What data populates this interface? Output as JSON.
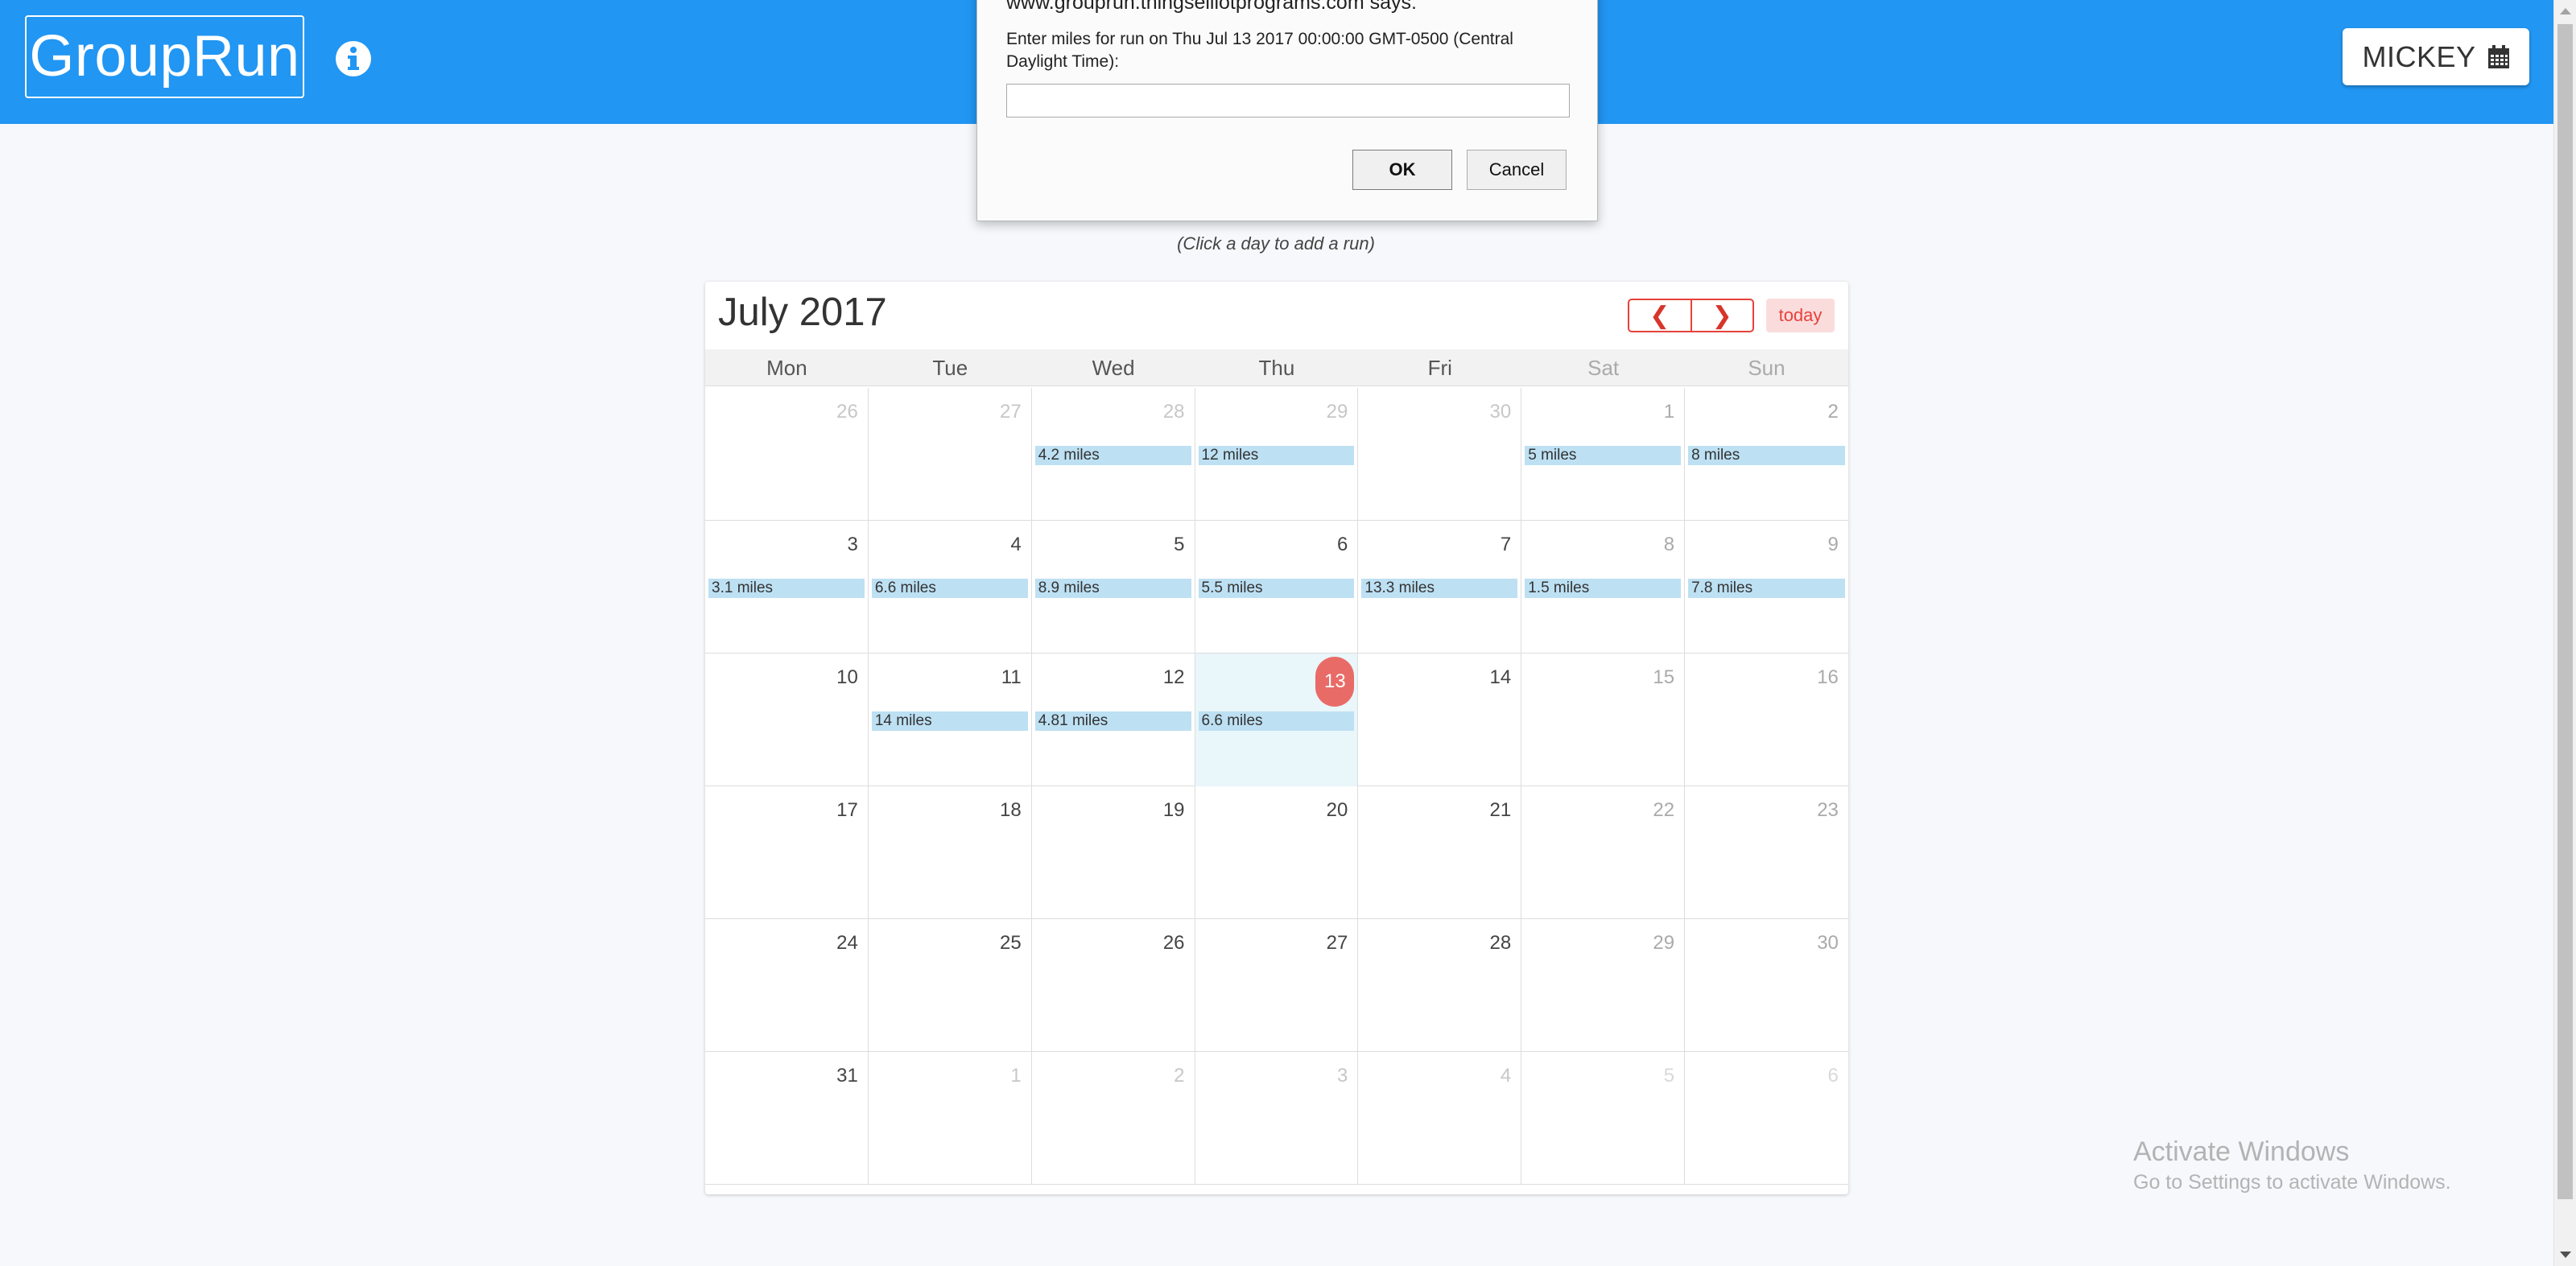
{
  "header": {
    "brand": "GroupRun",
    "user_label": "MICKEY",
    "icons": {
      "info": "info-circle-icon",
      "calendar": "calendar-icon"
    },
    "color": "#2196f3"
  },
  "dialog": {
    "title": "www.grouprun.thingselliotprograms.com says:",
    "message": "Enter miles for run on Thu Jul 13 2017 00:00:00 GMT-0500 (Central Daylight Time):",
    "input_value": "",
    "ok_label": "OK",
    "cancel_label": "Cancel"
  },
  "hint": "(Click a day to add a run)",
  "calendar": {
    "title": "July 2017",
    "prev_label": "❮",
    "next_label": "❯",
    "today_label": "today",
    "accent_color": "#e5423a",
    "days_of_week": [
      "Mon",
      "Tue",
      "Wed",
      "Thu",
      "Fri",
      "Sat",
      "Sun"
    ],
    "weeks": [
      [
        {
          "num": "26",
          "other": true,
          "event": ""
        },
        {
          "num": "27",
          "other": true,
          "event": ""
        },
        {
          "num": "28",
          "other": true,
          "event": "4.2 miles"
        },
        {
          "num": "29",
          "other": true,
          "event": "12 miles"
        },
        {
          "num": "30",
          "other": true,
          "event": ""
        },
        {
          "num": "1",
          "other": false,
          "event": "5 miles"
        },
        {
          "num": "2",
          "other": false,
          "event": "8 miles"
        }
      ],
      [
        {
          "num": "3",
          "other": false,
          "event": "3.1 miles"
        },
        {
          "num": "4",
          "other": false,
          "event": "6.6 miles"
        },
        {
          "num": "5",
          "other": false,
          "event": "8.9 miles"
        },
        {
          "num": "6",
          "other": false,
          "event": "5.5 miles"
        },
        {
          "num": "7",
          "other": false,
          "event": "13.3 miles"
        },
        {
          "num": "8",
          "other": false,
          "event": "1.5 miles"
        },
        {
          "num": "9",
          "other": false,
          "event": "7.8 miles"
        }
      ],
      [
        {
          "num": "10",
          "other": false,
          "event": ""
        },
        {
          "num": "11",
          "other": false,
          "event": "14 miles"
        },
        {
          "num": "12",
          "other": false,
          "event": "4.81 miles"
        },
        {
          "num": "13",
          "other": false,
          "event": "6.6 miles",
          "today": true
        },
        {
          "num": "14",
          "other": false,
          "event": ""
        },
        {
          "num": "15",
          "other": false,
          "event": ""
        },
        {
          "num": "16",
          "other": false,
          "event": ""
        }
      ],
      [
        {
          "num": "17",
          "other": false,
          "event": ""
        },
        {
          "num": "18",
          "other": false,
          "event": ""
        },
        {
          "num": "19",
          "other": false,
          "event": ""
        },
        {
          "num": "20",
          "other": false,
          "event": ""
        },
        {
          "num": "21",
          "other": false,
          "event": ""
        },
        {
          "num": "22",
          "other": false,
          "event": ""
        },
        {
          "num": "23",
          "other": false,
          "event": ""
        }
      ],
      [
        {
          "num": "24",
          "other": false,
          "event": ""
        },
        {
          "num": "25",
          "other": false,
          "event": ""
        },
        {
          "num": "26",
          "other": false,
          "event": ""
        },
        {
          "num": "27",
          "other": false,
          "event": ""
        },
        {
          "num": "28",
          "other": false,
          "event": ""
        },
        {
          "num": "29",
          "other": false,
          "event": ""
        },
        {
          "num": "30",
          "other": false,
          "event": ""
        }
      ],
      [
        {
          "num": "31",
          "other": false,
          "event": ""
        },
        {
          "num": "1",
          "other": true,
          "event": ""
        },
        {
          "num": "2",
          "other": true,
          "event": ""
        },
        {
          "num": "3",
          "other": true,
          "event": ""
        },
        {
          "num": "4",
          "other": true,
          "event": ""
        },
        {
          "num": "5",
          "other": true,
          "event": ""
        },
        {
          "num": "6",
          "other": true,
          "event": ""
        }
      ]
    ]
  },
  "watermark": {
    "line1": "Activate Windows",
    "line2": "Go to Settings to activate Windows."
  }
}
